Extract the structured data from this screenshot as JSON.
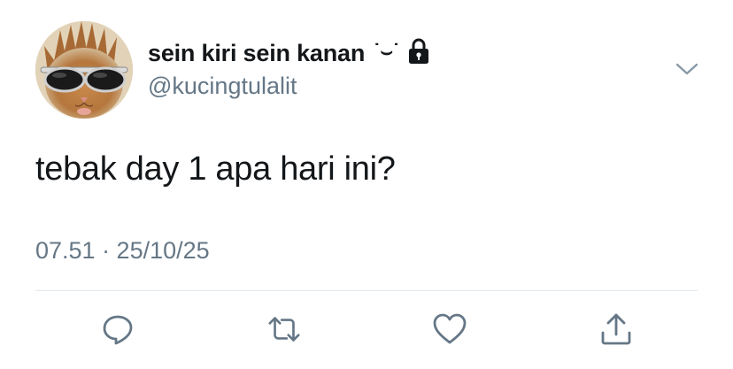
{
  "author": {
    "display_name": "sein kiri sein kanan",
    "name_emoticon": "˙⌣˙",
    "handle": "@kucingtulalit",
    "avatar_icon": "cat-with-sunglasses-avatar",
    "verified_lock_icon": "lock-icon"
  },
  "tweet": {
    "text": "tebak day 1 apa hari ini?",
    "timestamp": "07.51 · 25/10/25"
  },
  "actions": {
    "reply_icon": "reply-icon",
    "retweet_icon": "retweet-icon",
    "like_icon": "heart-icon",
    "share_icon": "share-icon"
  },
  "colors": {
    "primary_text": "#14171a",
    "secondary_text": "#657786",
    "icon": "#657786",
    "divider": "#e1e8ed",
    "background": "#ffffff"
  }
}
